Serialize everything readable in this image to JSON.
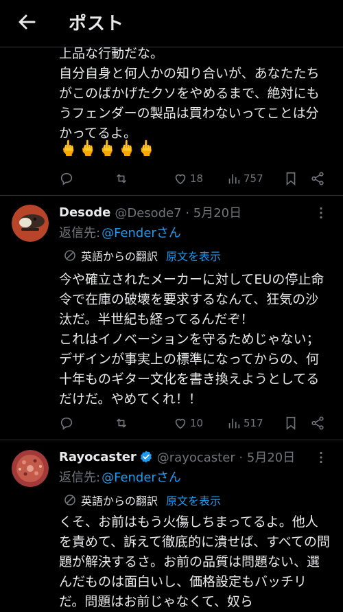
{
  "header": {
    "title": "ポスト"
  },
  "posts": [
    {
      "body": "上品な行動だな。\n自分自身と何人かの知り合いが、あなたたちがこのばかげたクソをやめるまで、絶対にもうフェンダーの製品は買わないってことは分かってるよ。",
      "emoji": "🖕🖕🖕🖕🖕",
      "replies": "",
      "reposts": "",
      "likes": "18",
      "views": "757"
    },
    {
      "name": "Desode",
      "handle": "@Desode7 · 5月20日",
      "reply_prefix": "返信先:",
      "reply_to": "@Fenderさん",
      "translation_label": "英語からの翻訳",
      "show_original": "原文を表示",
      "body": "今や確立されたメーカーに対してEUの停止命令で在庫の破壊を要求するなんて、狂気の沙汰だ。半世紀も経ってるんだぞ！\nこれはイノベーションを守るためじゃない；デザインが事実上の標準になってからの、何十年ものギター文化を書き換えようとしてるだけだ。やめてくれ！！",
      "likes": "10",
      "views": "517"
    },
    {
      "name": "Rayocaster",
      "handle": "@rayocaster · 5月20日",
      "reply_prefix": "返信先:",
      "reply_to": "@Fenderさん",
      "translation_label": "英語からの翻訳",
      "show_original": "原文を表示",
      "body": "くそ、お前はもう火傷しちまってるよ。他人を責めて、訴えて徹底的に潰せば、すべての問題が解決するさ。お前の品質は問題ない、選んだものは面白いし、価格設定もバッチリだ。問題はお前じゃなくて、奴ら"
    }
  ],
  "colors": {
    "background": "#000000",
    "text": "#e7e9ea",
    "muted": "#71767b",
    "accent": "#1d9bf0",
    "divider": "#2f3336"
  }
}
